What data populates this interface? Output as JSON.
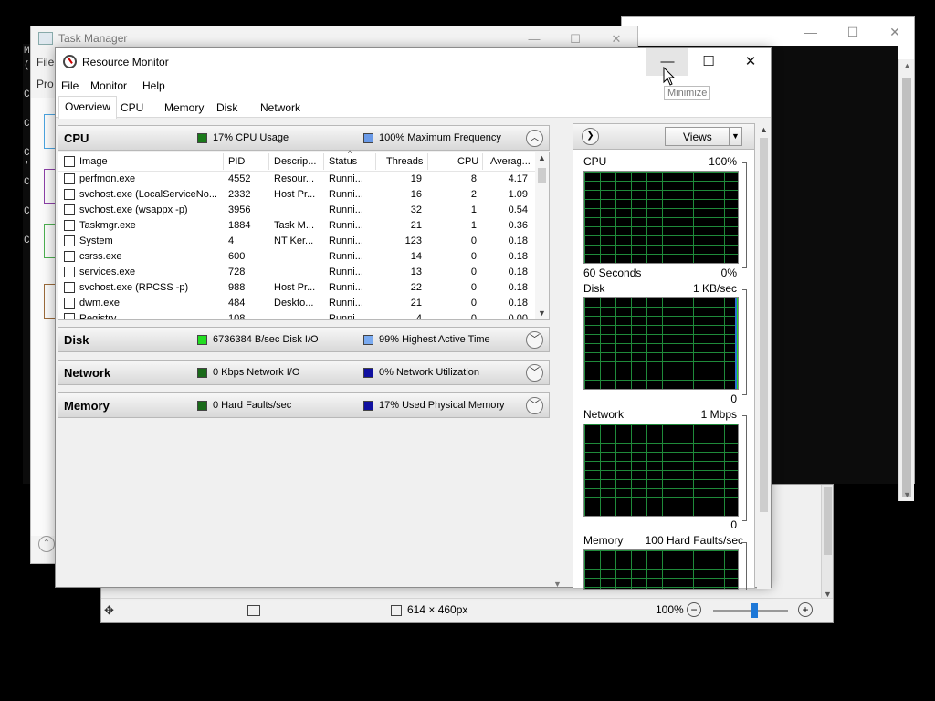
{
  "background": {
    "console_window": {
      "minimize": "—",
      "maximize": "☐",
      "close": "✕"
    },
    "cmd_fragments": [
      "M",
      "(",
      "C",
      "C",
      "C",
      "'",
      "C",
      "C",
      "C"
    ],
    "task_manager": {
      "title": "Task Manager",
      "menu_fragment": "File",
      "tab_fragment": "Pro",
      "minimize": "—",
      "maximize": "☐",
      "close": "✕"
    },
    "image_viewer": {
      "dimensions": "614 × 460px",
      "zoom": "100%",
      "zoom_out": "−",
      "zoom_in": "+",
      "zoom_level": 0.55
    }
  },
  "resource_monitor": {
    "title": "Resource Monitor",
    "window_buttons": {
      "minimize": "—",
      "maximize": "☐",
      "close": "✕"
    },
    "tooltip": "Minimize",
    "menu": [
      "File",
      "Monitor",
      "Help"
    ],
    "tabs": [
      "Overview",
      "CPU",
      "Memory",
      "Disk",
      "Network"
    ],
    "active_tab": "Overview",
    "cpu_pane": {
      "title": "CPU",
      "stat1": "17% CPU Usage",
      "stat2": "100% Maximum Frequency",
      "stat1_color": "#1a7a1a",
      "stat2_color": "#6a9ae8",
      "columns": [
        "Image",
        "PID",
        "Descrip...",
        "Status",
        "Threads",
        "CPU",
        "Averag..."
      ],
      "rows": [
        {
          "image": "perfmon.exe",
          "pid": "4552",
          "desc": "Resour...",
          "status": "Runni...",
          "threads": "19",
          "cpu": "8",
          "avg": "4.17"
        },
        {
          "image": "svchost.exe (LocalServiceNo...",
          "pid": "2332",
          "desc": "Host Pr...",
          "status": "Runni...",
          "threads": "16",
          "cpu": "2",
          "avg": "1.09"
        },
        {
          "image": "svchost.exe (wsappx -p)",
          "pid": "3956",
          "desc": "",
          "status": "Runni...",
          "threads": "32",
          "cpu": "1",
          "avg": "0.54"
        },
        {
          "image": "Taskmgr.exe",
          "pid": "1884",
          "desc": "Task M...",
          "status": "Runni...",
          "threads": "21",
          "cpu": "1",
          "avg": "0.36"
        },
        {
          "image": "System",
          "pid": "4",
          "desc": "NT Ker...",
          "status": "Runni...",
          "threads": "123",
          "cpu": "0",
          "avg": "0.18"
        },
        {
          "image": "csrss.exe",
          "pid": "600",
          "desc": "",
          "status": "Runni...",
          "threads": "14",
          "cpu": "0",
          "avg": "0.18"
        },
        {
          "image": "services.exe",
          "pid": "728",
          "desc": "",
          "status": "Runni...",
          "threads": "13",
          "cpu": "0",
          "avg": "0.18"
        },
        {
          "image": "svchost.exe (RPCSS -p)",
          "pid": "988",
          "desc": "Host Pr...",
          "status": "Runni...",
          "threads": "22",
          "cpu": "0",
          "avg": "0.18"
        },
        {
          "image": "dwm.exe",
          "pid": "484",
          "desc": "Deskto...",
          "status": "Runni...",
          "threads": "21",
          "cpu": "0",
          "avg": "0.18"
        },
        {
          "image": "Registry",
          "pid": "108",
          "desc": "",
          "status": "Runni...",
          "threads": "4",
          "cpu": "0",
          "avg": "0.00"
        }
      ]
    },
    "disk_pane": {
      "title": "Disk",
      "stat1": "6736384 B/sec Disk I/O",
      "stat2": "99% Highest Active Time",
      "stat1_color": "#22dd22",
      "stat2_color": "#7aaaf0"
    },
    "network_pane": {
      "title": "Network",
      "stat1": "0 Kbps Network I/O",
      "stat2": "0% Network Utilization",
      "stat1_color": "#1a6a1a",
      "stat2_color": "#1010a0"
    },
    "memory_pane": {
      "title": "Memory",
      "stat1": "0 Hard Faults/sec",
      "stat2": "17% Used Physical Memory",
      "stat1_color": "#1a6a1a",
      "stat2_color": "#1010a0"
    },
    "chart_panel": {
      "views_label": "Views",
      "charts": [
        {
          "name": "CPU",
          "max": "100%",
          "bottom_left": "60 Seconds",
          "bottom_right": "0%"
        },
        {
          "name": "Disk",
          "max": "1 KB/sec",
          "bottom_left": "",
          "bottom_right": "0"
        },
        {
          "name": "Network",
          "max": "1 Mbps",
          "bottom_left": "",
          "bottom_right": "0"
        },
        {
          "name": "Memory",
          "max": "100 Hard Faults/sec",
          "bottom_left": "",
          "bottom_right": ""
        }
      ],
      "grid_color": "#1f8a3a"
    }
  }
}
